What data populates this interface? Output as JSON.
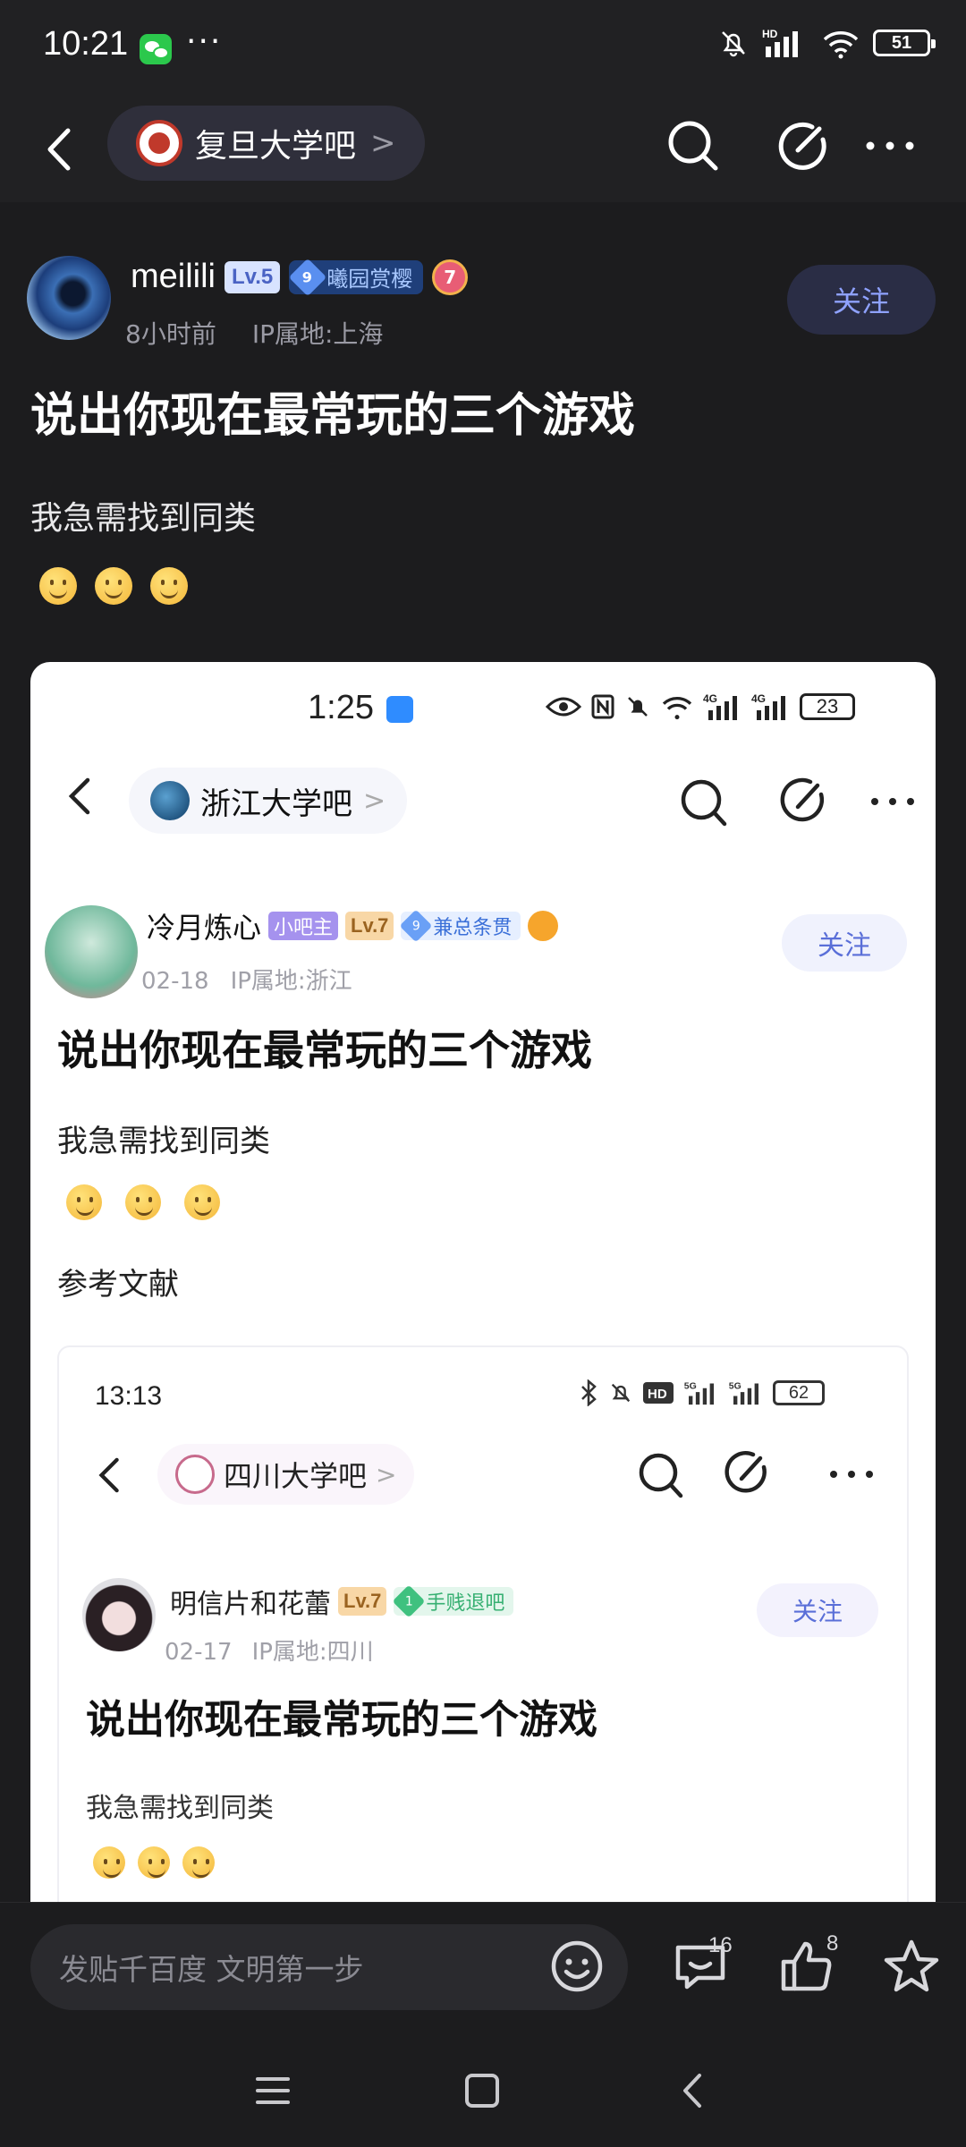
{
  "status_bar": {
    "time": "10:21",
    "more": "···",
    "battery": "51",
    "network": "HD"
  },
  "nav": {
    "forum_name": "复旦大学吧",
    "chevron": ">"
  },
  "post": {
    "author": "meilili",
    "level": "Lv.5",
    "honor_level": "9",
    "honor_title": "曦园赏樱",
    "medal": "7",
    "time": "8小时前",
    "ip": "IP属地:上海",
    "follow_label": "关注",
    "title": "说出你现在最常玩的三个游戏",
    "body": "我急需找到同类"
  },
  "screenshot_1": {
    "time": "1:25",
    "battery": "23",
    "network": "4G",
    "forum_name": "浙江大学吧",
    "chevron": ">",
    "author": "冷月炼心",
    "tag_admin": "小吧主",
    "level": "Lv.7",
    "honor_level": "9",
    "honor_title": "兼总条贯",
    "date": "02-18",
    "ip": "IP属地:浙江",
    "follow_label": "关注",
    "title": "说出你现在最常玩的三个游戏",
    "body": "我急需找到同类",
    "reference": "参考文献"
  },
  "screenshot_2": {
    "time": "13:13",
    "battery": "62",
    "network": "5G",
    "forum_name": "四川大学吧",
    "chevron": ">",
    "author": "明信片和花蕾",
    "level": "Lv.7",
    "honor_level": "1",
    "honor_title": "手贱退吧",
    "date": "02-17",
    "ip": "IP属地:四川",
    "follow_label": "关注",
    "title": "说出你现在最常玩的三个游戏",
    "body": "我急需找到同类"
  },
  "action_bar": {
    "comment_placeholder": "发贴千百度 文明第一步",
    "comment_count": "16",
    "like_count": "8"
  },
  "colors": {
    "background": "#1c1c1e",
    "accent": "#8fa2ff",
    "follow_bg": "#2a2d45"
  }
}
